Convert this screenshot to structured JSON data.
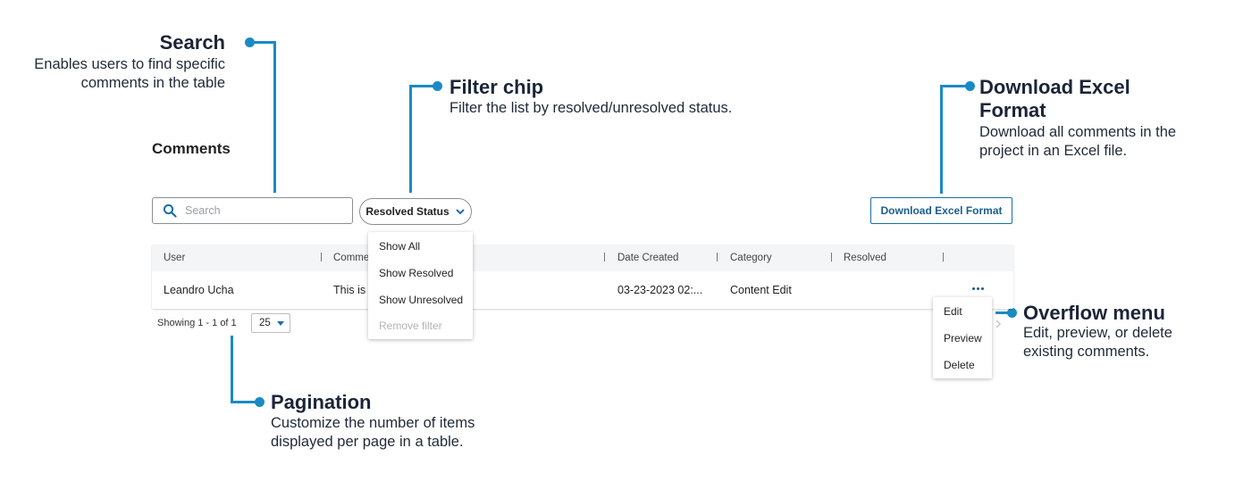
{
  "annotations": {
    "search": {
      "title": "Search",
      "desc1": "Enables users to find specific",
      "desc2": "comments in the table"
    },
    "filter": {
      "title": "Filter chip",
      "desc1": "Filter the list by resolved/unresolved status."
    },
    "download": {
      "title1": "Download Excel",
      "title2": "Format",
      "desc1": "Download all comments in the",
      "desc2": "project in an Excel file."
    },
    "overflow": {
      "title": "Overflow menu",
      "desc1": "Edit, preview, or delete",
      "desc2": "existing comments."
    },
    "pagination": {
      "title": "Pagination",
      "desc1": "Customize the number of items",
      "desc2": "displayed per page in a table."
    }
  },
  "page": {
    "title": "Comments"
  },
  "search": {
    "placeholder": "Search"
  },
  "filter_chip": {
    "label": "Resolved Status"
  },
  "filter_menu": {
    "items": [
      "Show All",
      "Show Resolved",
      "Show Unresolved"
    ],
    "disabled_item": "Remove filter"
  },
  "download_button": {
    "label": "Download Excel Format"
  },
  "table": {
    "columns": [
      "User",
      "Commen",
      "Date Created",
      "Category",
      "Resolved"
    ],
    "rows": [
      {
        "user": "Leandro Ucha",
        "comment": "This is",
        "date_created": "03-23-2023 02:...",
        "category": "Content Edit",
        "resolved": ""
      }
    ]
  },
  "pagination": {
    "showing": "Showing 1 - 1 of 1",
    "page_size": "25"
  },
  "overflow_menu": {
    "items": [
      "Edit",
      "Preview",
      "Delete"
    ]
  },
  "colors": {
    "accent": "#1a8ac4",
    "button_text": "#1b5d8d"
  },
  "icons": {
    "search": "search-icon",
    "chip_caret": "chevron-down-icon",
    "row_menu": "more-horizontal-icon",
    "page_next": "chevron-right-icon"
  }
}
